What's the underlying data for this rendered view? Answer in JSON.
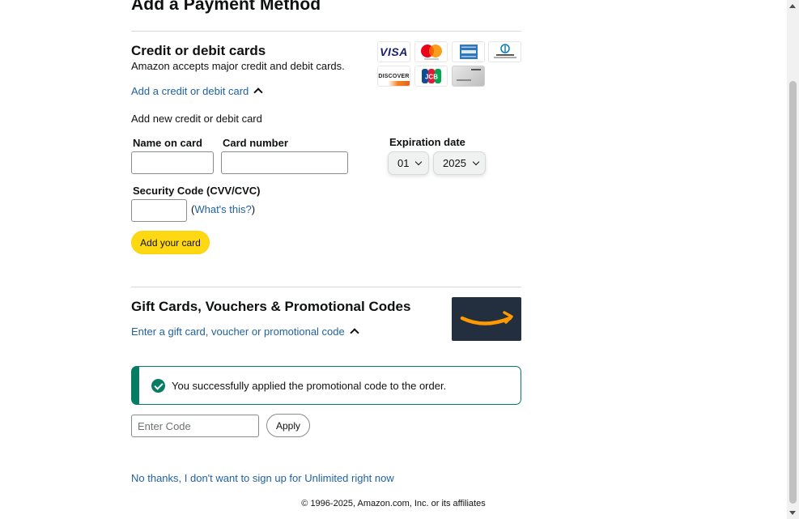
{
  "page": {
    "title": "Add a Payment Method"
  },
  "cards_section": {
    "title": "Credit or debit cards",
    "subtitle": "Amazon accepts major credit and debit cards.",
    "toggle_link": "Add a credit or debit card",
    "form_heading": "Add new credit or debit card",
    "name_label": "Name on card",
    "name_value": "",
    "number_label": "Card number",
    "number_value": "",
    "expiration_label": "Expiration date",
    "month_value": "01",
    "year_value": "2025",
    "cvv_label": "Security Code (CVV/CVC)",
    "cvv_value": "",
    "whats_this_open": "(",
    "whats_this_link": "What's this?",
    "whats_this_close": ")",
    "submit_label": "Add your card",
    "logos": {
      "visa": "VISA",
      "discover": "DISCOVER",
      "jcb": "JCB"
    }
  },
  "gift_section": {
    "title": "Gift Cards, Vouchers & Promotional Codes",
    "toggle_link": "Enter a gift card, voucher or promotional code",
    "success_message": "You successfully applied the promotional code to the order.",
    "code_placeholder": "Enter Code",
    "apply_label": "Apply"
  },
  "decline_link": "No thanks, I don't want to sign up for Unlimited right now",
  "footer": "© 1996-2025, Amazon.com, Inc. or its affiliates",
  "colors": {
    "link": "#2162a1",
    "button_primary": "#ffd814",
    "success": "#067d62",
    "gift_card_bg": "#232f3e",
    "amazon_smile": "#ff9900"
  },
  "icons": [
    "chevron-up-icon",
    "check-circle-icon",
    "visa-logo",
    "mastercard-logo",
    "amex-logo",
    "diners-club-logo",
    "discover-logo",
    "jcb-logo",
    "amazon-store-card-logo",
    "amazon-smile-logo"
  ]
}
